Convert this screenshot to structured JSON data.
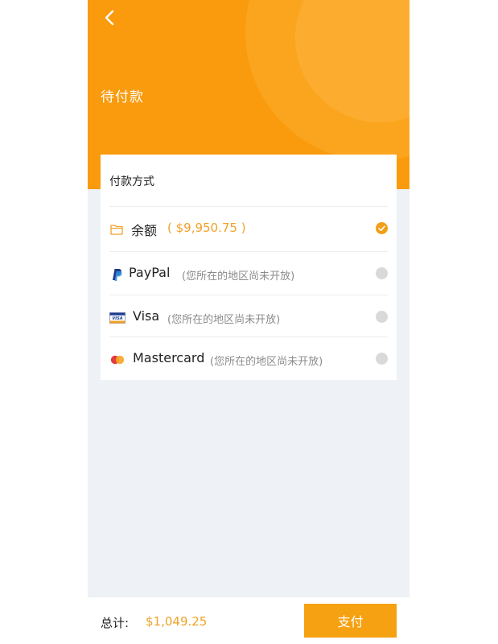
{
  "header": {
    "title": "待付款",
    "back_icon": "chevron-left-icon"
  },
  "payment": {
    "section_title": "付款方式",
    "methods": [
      {
        "name": "余额",
        "amount": "( $9,950.75 )",
        "note": "",
        "icon": "wallet-icon",
        "selected": true
      },
      {
        "name": "PayPal",
        "amount": "",
        "note": "(您所在的地区尚未开放)",
        "icon": "paypal-icon",
        "selected": false
      },
      {
        "name": "Visa",
        "amount": "",
        "note": "(您所在的地区尚未开放)",
        "icon": "visa-card-icon",
        "selected": false
      },
      {
        "name": "Mastercard",
        "amount": "",
        "note": "(您所在的地区尚未开放)",
        "icon": "mastercard-icon",
        "selected": false
      }
    ]
  },
  "footer": {
    "total_label": "总计:",
    "total_value": "$1,049.25",
    "pay_label": "支付"
  },
  "colors": {
    "primary": "#f99b0d",
    "accent_text": "#f0a229",
    "button": "#f5a111",
    "background": "#eef1f6"
  }
}
